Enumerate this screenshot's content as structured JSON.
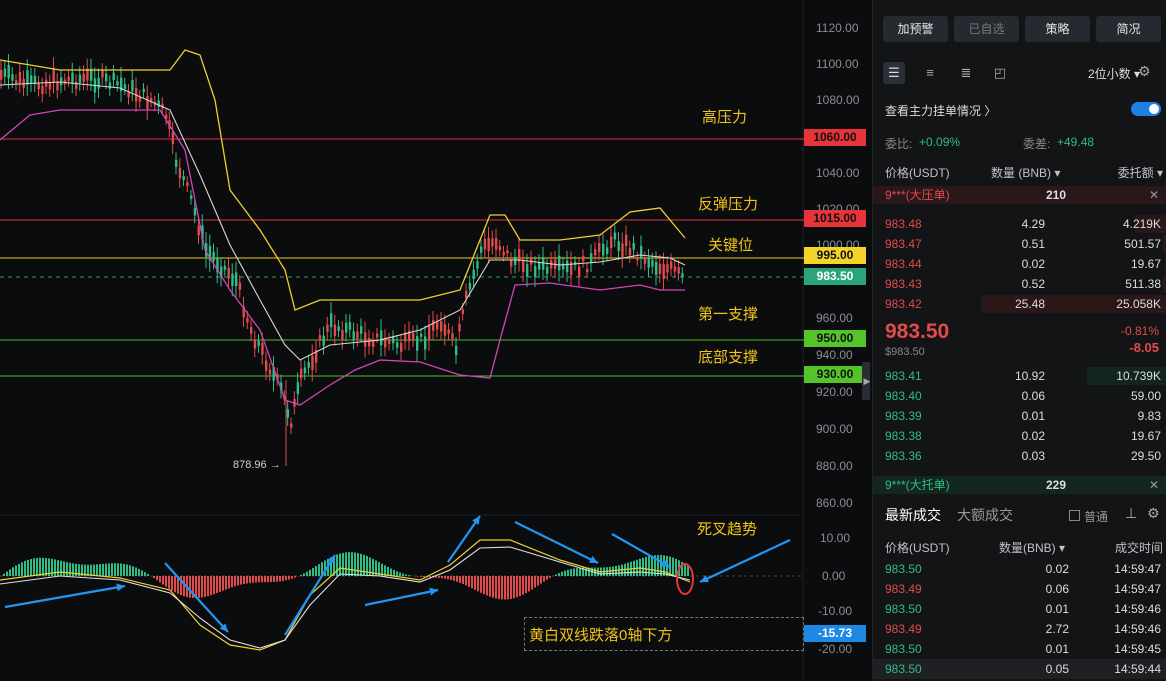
{
  "chart": {
    "y_axis_labels": [
      "1120.00",
      "1100.00",
      "1080.00",
      "1040.00",
      "1020.00",
      "1000.00",
      "960.00",
      "940.00",
      "920.00",
      "900.00",
      "880.00",
      "860.00"
    ],
    "macd_axis_labels": [
      "10.00",
      "0.00",
      "-10.00",
      "-20.00"
    ],
    "price_tags": [
      {
        "value": "1060.00",
        "color": "#e6343a"
      },
      {
        "value": "1015.00",
        "color": "#e6343a"
      },
      {
        "value": "995.00",
        "color": "#f3d42b"
      },
      {
        "value": "983.50",
        "color": "#2aa57a"
      },
      {
        "value": "950.00",
        "color": "#54c42a"
      },
      {
        "value": "930.00",
        "color": "#54c42a"
      },
      {
        "value": "-15.73",
        "color": "#1e88e5"
      }
    ],
    "annotations": {
      "high_pressure": "高压力",
      "rebound_pressure": "反弹压力",
      "key_level": "关键位",
      "first_support": "第一支撑",
      "bottom_support": "底部支撑",
      "death_cross": "死叉趋势",
      "macd_note": "黄白双线跌落0轴下方"
    },
    "low_marker": "878.96 →",
    "expand_icon": "chevron-right-icon"
  },
  "sidebar": {
    "buttons": [
      "加预警",
      "已自选",
      "策略",
      "简况"
    ],
    "decimals": "2位小数 ▾",
    "main_orders_label": "查看主力挂单情况 〉",
    "ratio_label": "委比:",
    "ratio_value": "+0.09%",
    "diff_label": "委差:",
    "diff_value": "+49.48",
    "orderbook_headers": {
      "price": "价格(USDT)",
      "qty": "数量 (BNB) ▾",
      "total": "委托额 ▾"
    },
    "big_ask": {
      "label": "9***(大压单)",
      "qty": "210"
    },
    "asks": [
      {
        "price": "983.48",
        "qty": "4.29",
        "total": "4.219K",
        "depth": 0.17
      },
      {
        "price": "983.47",
        "qty": "0.51",
        "total": "501.57",
        "depth": 0.02
      },
      {
        "price": "983.44",
        "qty": "0.02",
        "total": "19.67",
        "depth": 0.01
      },
      {
        "price": "983.43",
        "qty": "0.52",
        "total": "511.38",
        "depth": 0.02
      },
      {
        "price": "983.42",
        "qty": "25.48",
        "total": "25.058K",
        "depth": 1.0
      }
    ],
    "last_price": "983.50",
    "last_usd": "$983.50",
    "last_pct": "-0.81%",
    "last_change": "-8.05",
    "bids": [
      {
        "price": "983.41",
        "qty": "10.92",
        "total": "10.739K",
        "depth": 0.43
      },
      {
        "price": "983.40",
        "qty": "0.06",
        "total": "59.00",
        "depth": 0.0
      },
      {
        "price": "983.39",
        "qty": "0.01",
        "total": "9.83",
        "depth": 0.0
      },
      {
        "price": "983.38",
        "qty": "0.02",
        "total": "19.67",
        "depth": 0.0
      },
      {
        "price": "983.36",
        "qty": "0.03",
        "total": "29.50",
        "depth": 0.0
      }
    ],
    "big_bid": {
      "label": "9***(大托单)",
      "qty": "229"
    },
    "trade_tabs": [
      "最新成交",
      "大额成交"
    ],
    "normal_label": "普通",
    "trades_headers": {
      "price": "价格(USDT)",
      "qty": "数量(BNB) ▾",
      "time": "成交时间"
    },
    "trades": [
      {
        "price": "983.50",
        "qty": "0.02",
        "time": "14:59:47",
        "side": "buy"
      },
      {
        "price": "983.49",
        "qty": "0.06",
        "time": "14:59:47",
        "side": "sell"
      },
      {
        "price": "983.50",
        "qty": "0.01",
        "time": "14:59:46",
        "side": "buy"
      },
      {
        "price": "983.49",
        "qty": "2.72",
        "time": "14:59:46",
        "side": "sell"
      },
      {
        "price": "983.50",
        "qty": "0.01",
        "time": "14:59:45",
        "side": "buy"
      },
      {
        "price": "983.50",
        "qty": "0.05",
        "time": "14:59:44",
        "side": "buy"
      }
    ]
  }
}
